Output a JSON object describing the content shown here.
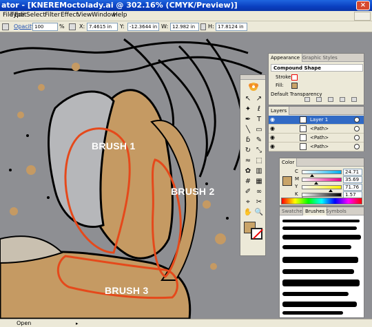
{
  "window": {
    "title": "ator - [KNEREMoctolady.ai @ 302.16% (CMYK/Preview)]",
    "close_glyph": "×"
  },
  "menu": {
    "items": [
      "File",
      "Edit",
      "Type",
      "Select",
      "Filter",
      "Effect",
      "View",
      "Window",
      "Help"
    ]
  },
  "control": {
    "opacity_label": "Opacity:",
    "opacity_value": "100",
    "opacity_unit": "%",
    "x_label": "X:",
    "x_value": "7.4615 in",
    "y_label": "Y:",
    "y_value": "-12.3644 in",
    "w_label": "W:",
    "w_value": "12.982 in",
    "h_label": "H:",
    "h_value": "17.8124 in"
  },
  "artwork": {
    "brush_labels": [
      "BRUSH 1",
      "BRUSH 2",
      "BRUSH 3"
    ],
    "colors": {
      "skin": "#c59a63",
      "gray": "#8e8f93",
      "ink": "#000000",
      "outline": "#e5491b"
    }
  },
  "tools": {
    "icons": [
      "selection-arrow-icon",
      "direct-select-icon",
      "magic-wand-icon",
      "lasso-icon",
      "pen-icon",
      "type-icon",
      "line-icon",
      "rectangle-icon",
      "paintbrush-icon",
      "pencil-icon",
      "rotate-icon",
      "scale-icon",
      "warp-icon",
      "free-transform-icon",
      "symbol-sprayer-icon",
      "graph-icon",
      "mesh-icon",
      "gradient-icon",
      "eyedropper-icon",
      "blend-icon",
      "slice-icon",
      "scissors-icon",
      "hand-icon",
      "zoom-icon"
    ],
    "glyphs": [
      "↖",
      "↗",
      "✦",
      "ℓ",
      "✒",
      "T",
      "╲",
      "▭",
      "ɓ",
      "✎",
      "↻",
      "⤡",
      "≈",
      "⬚",
      "✿",
      "▥",
      "#",
      "▦",
      "✐",
      "∞",
      "⌖",
      "✂",
      "✋",
      "🔍"
    ],
    "fill_color": "#c9a468"
  },
  "appearance": {
    "tabs": [
      "Appearance",
      "Graphic Styles"
    ],
    "heading": "Compound Shape",
    "stroke_label": "Stroke:",
    "fill_label": "Fill:",
    "default_label": "Default Transparency"
  },
  "layers": {
    "tab": "Layers",
    "rows": [
      {
        "name": "Layer 1",
        "selected": true
      },
      {
        "name": "<Path>",
        "selected": false
      },
      {
        "name": "<Path>",
        "selected": false
      },
      {
        "name": "<Path>",
        "selected": false
      }
    ]
  },
  "color": {
    "tab": "Color",
    "channels": [
      {
        "key": "C",
        "value": "24.71",
        "pos": 0.25,
        "grad": "linear-gradient(90deg,#fff,#00aeef)"
      },
      {
        "key": "M",
        "value": "35.69",
        "pos": 0.36,
        "grad": "linear-gradient(90deg,#fff,#ec008c)"
      },
      {
        "key": "Y",
        "value": "71.76",
        "pos": 0.72,
        "grad": "linear-gradient(90deg,#fff,#fff200)"
      },
      {
        "key": "K",
        "value": "1.57",
        "pos": 0.02,
        "grad": "linear-gradient(90deg,#fff,#000)"
      }
    ],
    "swatch": "#c9a468"
  },
  "brushes": {
    "tabs": [
      "Swatches",
      "Brushes",
      "Symbols"
    ]
  },
  "status": {
    "label": "Open"
  }
}
